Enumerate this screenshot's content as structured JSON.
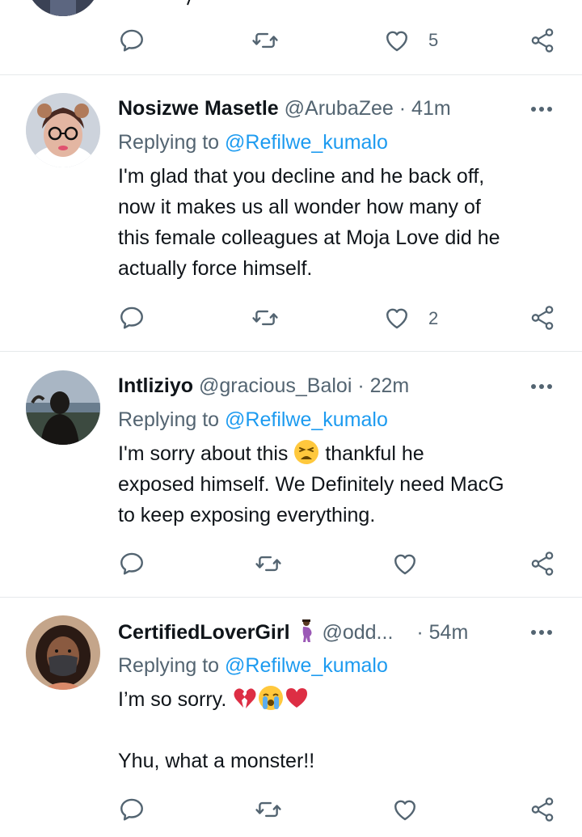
{
  "top_tweet": {
    "actions": {
      "likes": "5"
    }
  },
  "tweets": [
    {
      "name": "Nosizwe Masetle",
      "handle": "@ArubaZee",
      "dot": "·",
      "time": "41m",
      "replying_prefix": "Replying to ",
      "replying_to": "@Refilwe_kumalo",
      "text_lines": [
        "I'm glad that you decline and he back off,",
        "now it makes us all wonder how many of",
        "this female colleagues at Moja Love did he",
        "actually force himself."
      ],
      "likes": "2"
    },
    {
      "name": "Intliziyo",
      "handle": "@gracious_Baloi",
      "dot": "·",
      "time": "22m",
      "replying_prefix": "Replying to ",
      "replying_to": "@Refilwe_kumalo",
      "text_line1_a": "I'm sorry about this",
      "text_line1_b": "thankful he",
      "text_lines_rest": [
        "exposed himself. We Definitely need MacG",
        "to keep exposing everything."
      ],
      "emoji": "tired-face-emoji",
      "likes": ""
    },
    {
      "name": "CertifiedLoverGirl",
      "handle": "@odd...",
      "dot": "·",
      "time": "54m",
      "replying_prefix": "Replying to ",
      "replying_to": "@Refilwe_kumalo",
      "text_line1": "I’m so sorry.",
      "text_line2": "Yhu, what a monster!!",
      "emojis": [
        "broken-heart-emoji",
        "loudly-crying-face-emoji",
        "red-heart-emoji"
      ],
      "name_emoji": "pregnant-woman-emoji",
      "likes": ""
    }
  ],
  "icons": {
    "reply": "reply-icon",
    "retweet": "retweet-icon",
    "like": "heart-icon",
    "share": "share-icon",
    "more": "more-dots-icon"
  },
  "colors": {
    "mention": "#1d9bf0",
    "secondary_text": "#536471",
    "primary_text": "#0f1419"
  }
}
